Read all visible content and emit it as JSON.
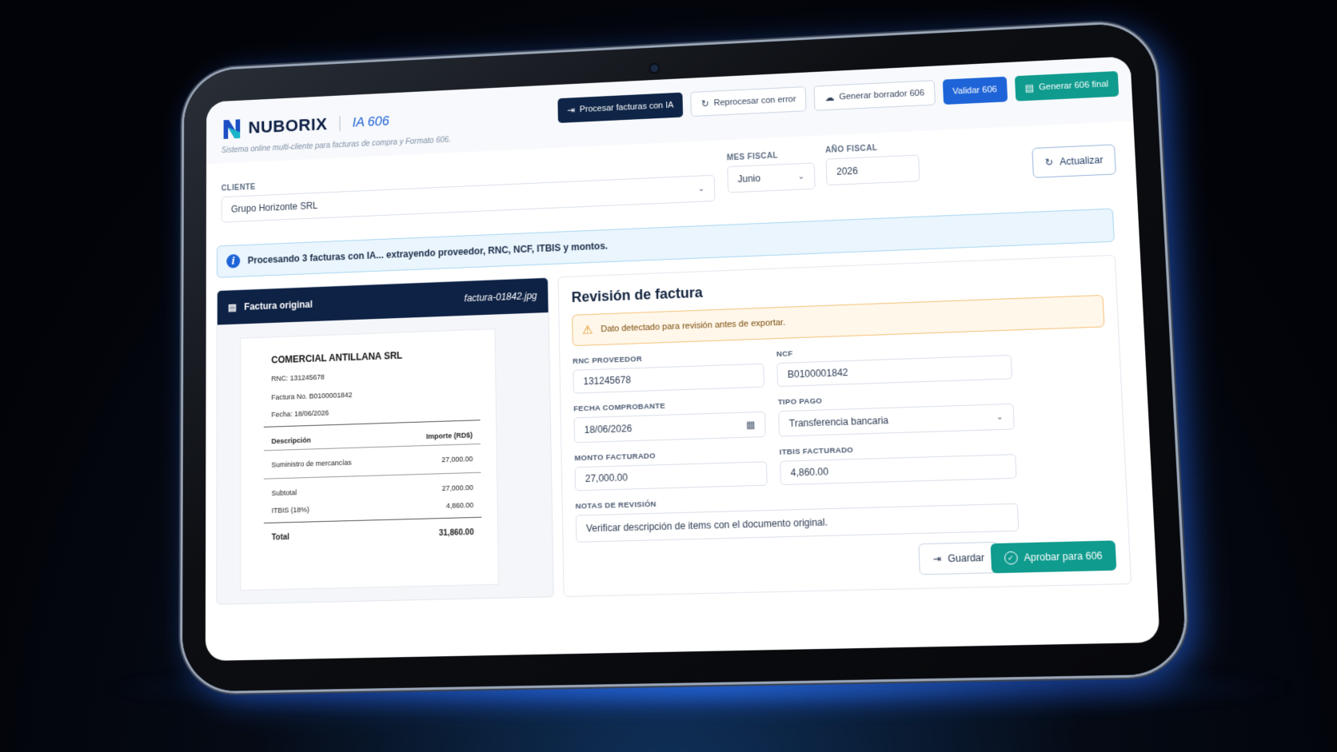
{
  "app": {
    "brand": "NUBORIX",
    "product": "IA 606",
    "subtitle": "Sistema online multi-cliente para facturas de compra y Formato 606."
  },
  "toolbar": {
    "process": "Procesar facturas con IA",
    "reprocess": "Reprocesar con error",
    "draft": "Generar borrador 606",
    "validate": "Validar 606",
    "final": "Generar 606 final"
  },
  "filters": {
    "client_label": "CLIENTE",
    "client_value": "Grupo Horizonte SRL",
    "month_label": "MES FISCAL",
    "month_value": "Junio",
    "year_label": "AÑO FISCAL",
    "year_value": "2026",
    "refresh": "Actualizar"
  },
  "banner": {
    "text": "Procesando 3 facturas con IA... extrayendo proveedor, RNC, NCF, ITBIS y montos."
  },
  "original": {
    "title": "Factura original",
    "filename": "factura-01842.jpg",
    "company": "COMERCIAL ANTILLANA SRL",
    "rnc": "RNC:  131245678",
    "invoice_no": "Factura No. B0100001842",
    "date": "Fecha:  18/06/2026",
    "col_desc": "Descripción",
    "col_amount": "Importe (RD$)",
    "item_desc": "Suministro de mercancías",
    "item_amount": "27,000.00",
    "subtotal_label": "Subtotal",
    "subtotal_value": "27,000.00",
    "itbis_label": "ITBIS (18%)",
    "itbis_value": "4,860.00",
    "total_label": "Total",
    "total_value": "31,860.00"
  },
  "review": {
    "title": "Revisión de factura",
    "warning": "Dato detectado para revisión antes de exportar.",
    "rnc_label": "RNC PROVEEDOR",
    "rnc_value": "131245678",
    "ncf_label": "NCF",
    "ncf_value": "B0100001842",
    "date_label": "FECHA COMPROBANTE",
    "date_value": "18/06/2026",
    "pay_label": "TIPO PAGO",
    "pay_value": "Transferencia bancaria",
    "amount_label": "MONTO FACTURADO",
    "amount_value": "27,000.00",
    "itbis_label": "ITBIS FACTURADO",
    "itbis_value": "4,860.00",
    "notes_label": "NOTAS DE REVISIÓN",
    "notes_value": "Verificar descripción de items con el documento original.",
    "save": "Guardar",
    "approve": "Aprobar para 606"
  },
  "colors": {
    "navy": "#0e2245",
    "accent_blue": "#1e64d8",
    "teal": "#0f9b8e",
    "warning": "#e09016"
  }
}
